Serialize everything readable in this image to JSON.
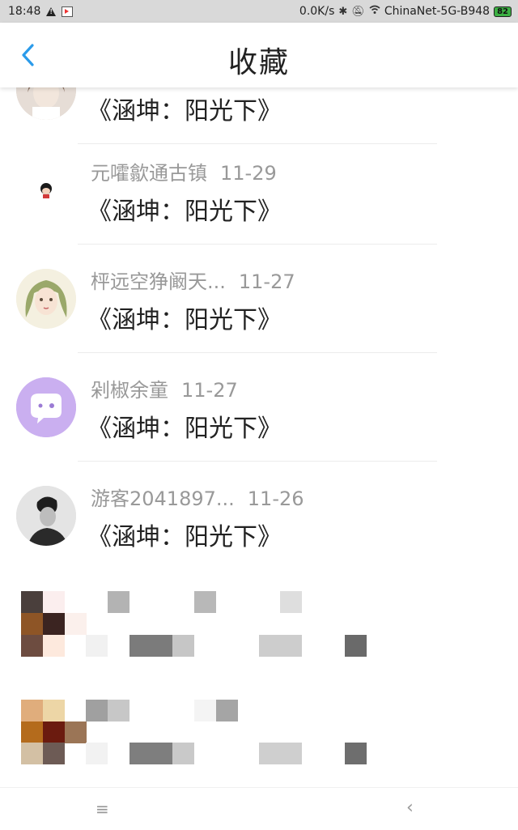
{
  "status_bar": {
    "time": "18:48",
    "net_speed": "0.0K/s",
    "wifi_name": "ChinaNet-5G-B948",
    "battery": "82",
    "icons": [
      "warning-icon",
      "app-notification-icon",
      "bluetooth-icon",
      "mute-bell-icon",
      "wifi-icon",
      "battery-icon"
    ]
  },
  "header": {
    "title": "收藏",
    "back_icon": "chevron-left-icon",
    "accent_color": "#2b9bea"
  },
  "favorites": [
    {
      "user": "",
      "date": "",
      "work": "《涵坤：阳光下》",
      "avatar": "photo-avatar"
    },
    {
      "user": "元嚯歙通古镇",
      "date": "11-29",
      "work": "《涵坤：阳光下》",
      "avatar": "cartoon-girl-avatar"
    },
    {
      "user": "枰远空狰阚天...",
      "date": "11-27",
      "work": "《涵坤：阳光下》",
      "avatar": "illustrated-girl-avatar"
    },
    {
      "user": "剁椒余童",
      "date": "11-27",
      "work": "《涵坤：阳光下》",
      "avatar": "chat-bubble-avatar"
    },
    {
      "user": "游客2041897...",
      "date": "11-26",
      "work": "《涵坤：阳光下》",
      "avatar": "bw-man-avatar"
    }
  ],
  "nav": {
    "menu_icon": "≡",
    "back_icon": "‹"
  }
}
